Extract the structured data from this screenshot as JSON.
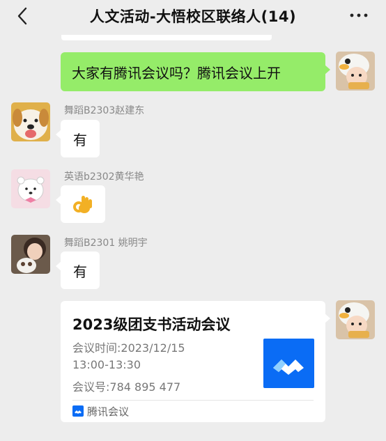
{
  "header": {
    "title": "人文活动-大悟校区联络人(14)"
  },
  "messages": [
    {
      "side": "right",
      "text": "大家有腾讯会议吗？腾讯会议上开"
    },
    {
      "side": "left",
      "sender": "舞蹈B2303赵建东",
      "text": "有"
    },
    {
      "side": "left",
      "sender": "英语b2302黄华艳",
      "emoji": "ok-hand"
    },
    {
      "side": "left",
      "sender": "舞蹈B2301 姚明宇",
      "text": "有"
    }
  ],
  "meeting_card": {
    "title": "2023级团支书活动会议",
    "time_label": "会议时间:2023/12/15",
    "time_range": "13:00-13:30",
    "meeting_id": "会议号:784 895 477",
    "app_name": "腾讯会议"
  },
  "colors": {
    "background": "#ededed",
    "self_bubble": "#95ec69",
    "other_bubble": "#ffffff",
    "tencent_meeting_blue": "#0a6cf5"
  },
  "icons": {
    "back": "chevron-left-icon",
    "more": "ellipsis-icon",
    "meeting_logo": "tencent-meeting-logo-icon"
  }
}
